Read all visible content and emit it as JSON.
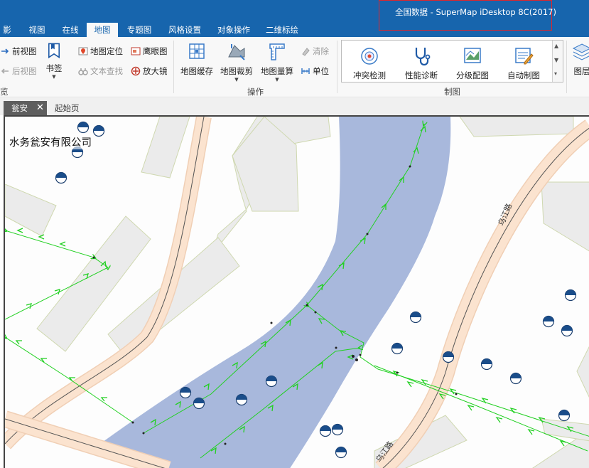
{
  "window": {
    "title": "全国数据 - SuperMap iDesktop 8C(2017)",
    "accent_color": "#1765ad"
  },
  "menu": {
    "tabs": [
      {
        "label": "影",
        "active": false
      },
      {
        "label": "视图",
        "active": false
      },
      {
        "label": "在线",
        "active": false
      },
      {
        "label": "地图",
        "active": true
      },
      {
        "label": "专题图",
        "active": false
      },
      {
        "label": "风格设置",
        "active": false
      },
      {
        "label": "对象操作",
        "active": false
      },
      {
        "label": "二维标绘",
        "active": false
      }
    ]
  },
  "ribbon": {
    "browse": {
      "forward_view": "前视图",
      "back_view": "后视图",
      "bookmark": "书签",
      "map_locate": "地图定位",
      "text_search": "文本查找",
      "eagle_eye": "鹰眼图",
      "magnifier": "放大镜",
      "group_label": "览"
    },
    "operations": {
      "map_cache": "地图缓存",
      "map_clip": "地图裁剪",
      "map_measure": "地图量算",
      "clear": "清除",
      "unit": "单位",
      "group_label": "操作"
    },
    "mapping": {
      "conflict_check": "冲突检测",
      "performance_diagnosis": "性能诊断",
      "graded_color": "分级配图",
      "auto_mapping": "自动制图",
      "group_label": "制图"
    },
    "layers_label": "图层"
  },
  "document_tabs": {
    "active": "瓮安",
    "start_page": "起始页"
  },
  "map": {
    "company_label": "水务瓮安有限公司",
    "road_labels": [
      "乌江路",
      "乌江路"
    ],
    "water_color": "#a8b8dc",
    "pipe_color": "#22d022",
    "road_fill_color": "#fbe3cf",
    "building_color": "#ebebeb"
  }
}
